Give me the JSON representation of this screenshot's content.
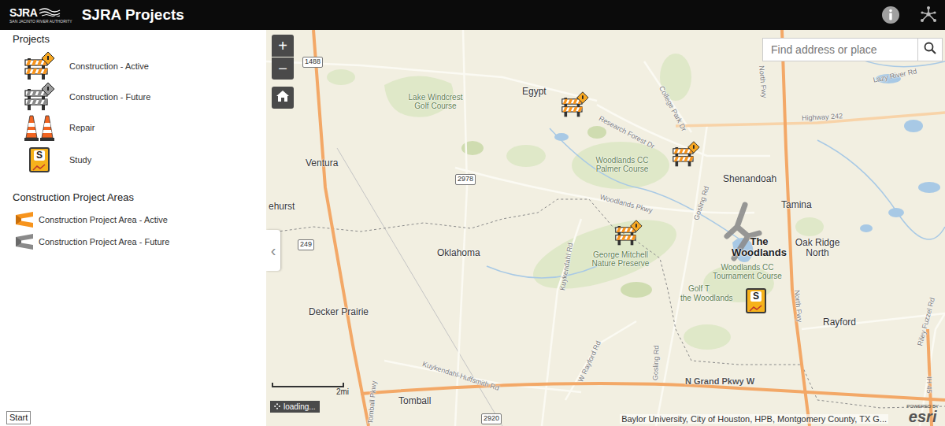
{
  "header": {
    "logo": "SJRA",
    "logo_subtitle": "SAN JACINTO RIVER AUTHORITY",
    "title": "SJRA Projects"
  },
  "legend": {
    "title": "Projects",
    "items": [
      {
        "label": "Construction - Active",
        "kind": "active"
      },
      {
        "label": "Construction - Future",
        "kind": "future"
      },
      {
        "label": "Repair",
        "kind": "repair"
      },
      {
        "label": "Study",
        "kind": "study",
        "badge": "S"
      }
    ]
  },
  "project_area_legend": {
    "title": "Construction Project Areas",
    "items": [
      {
        "label": "Construction Project Area - Active",
        "kind": "active"
      },
      {
        "label": "Construction Project Area - Future",
        "kind": "future"
      }
    ]
  },
  "panel_toggle": "‹",
  "start_button": "Start",
  "map": {
    "zoom_in": "+",
    "zoom_out": "−",
    "search": {
      "placeholder": "Find address or place"
    },
    "labels": [
      {
        "text": "Egypt",
        "kind": "place"
      },
      {
        "text": "Lake Windcrest Golf Course",
        "kind": "park"
      },
      {
        "text": "Ventura",
        "kind": "place"
      },
      {
        "text": "ehurst",
        "kind": "place"
      },
      {
        "text": "Oklahoma",
        "kind": "place"
      },
      {
        "text": "Decker Prairie",
        "kind": "place"
      },
      {
        "text": "Tomball",
        "kind": "place"
      },
      {
        "text": "Shenandoah",
        "kind": "place"
      },
      {
        "text": "Tamina",
        "kind": "place"
      },
      {
        "text": "The Woodlands",
        "kind": "bold"
      },
      {
        "text": "Oak Ridge North",
        "kind": "place"
      },
      {
        "text": "Woodlands CC Palmer Course",
        "kind": "park"
      },
      {
        "text": "George Mitchell Nature Preserve",
        "kind": "park"
      },
      {
        "text": "Woodlands CC Tournament Course",
        "kind": "park"
      },
      {
        "text": "Golf T",
        "kind": "park"
      },
      {
        "text": "the Woodlands",
        "kind": "park"
      },
      {
        "text": "Rayford",
        "kind": "place"
      },
      {
        "text": "Highway 242",
        "kind": "road"
      },
      {
        "text": "Lazy River Rd",
        "kind": "road"
      },
      {
        "text": "North Fwy",
        "kind": "road"
      },
      {
        "text": "North Fwy",
        "kind": "road"
      },
      {
        "text": "College Park Dr",
        "kind": "road"
      },
      {
        "text": "Research Forest Dr",
        "kind": "road"
      },
      {
        "text": "Woodlands Pkwy",
        "kind": "road"
      },
      {
        "text": "Gosling Rd",
        "kind": "road"
      },
      {
        "text": "Kuykendahl Rd",
        "kind": "road"
      },
      {
        "text": "W Rayford Rd",
        "kind": "road"
      },
      {
        "text": "Gosling Rd",
        "kind": "road"
      },
      {
        "text": "Kuykendahl-Huffsmith Rd",
        "kind": "road"
      },
      {
        "text": "N Grand Pkwy W",
        "kind": "major"
      },
      {
        "text": "IH 45",
        "kind": "road"
      },
      {
        "text": "Riley Fuzzel Rd",
        "kind": "road"
      },
      {
        "text": "Tomball Pkwy",
        "kind": "road"
      }
    ],
    "shields": [
      {
        "text": "1488"
      },
      {
        "text": "2978"
      },
      {
        "text": "249"
      },
      {
        "text": "2920"
      }
    ],
    "pins": [
      {
        "kind": "active"
      },
      {
        "kind": "active"
      },
      {
        "kind": "active"
      },
      {
        "kind": "study",
        "badge": "S"
      }
    ],
    "project_areas": [
      {
        "kind": "future"
      }
    ],
    "scale": "2mi",
    "status": "loading...",
    "attribution": "Baylor University, City of Houston, HPB, Montgomery County, TX G...",
    "powered_by": "POWERED BY",
    "esri": "esri"
  }
}
